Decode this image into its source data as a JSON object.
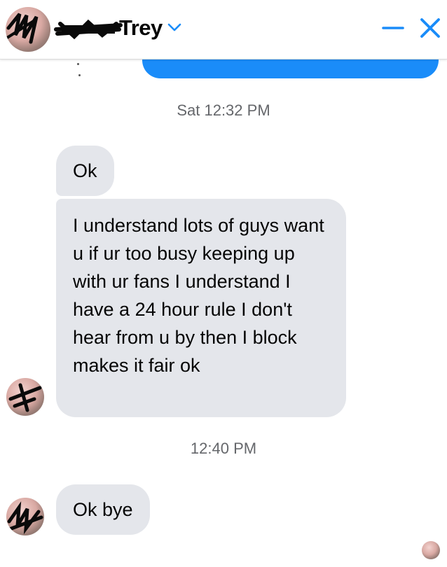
{
  "header": {
    "name": "Trey",
    "icons": {
      "chevron": "chevron-down-icon",
      "minimize": "minimize-icon",
      "close": "close-icon"
    },
    "accent_color": "#1a8cf9"
  },
  "messages": [
    {
      "type": "timestamp",
      "text": "Sat 12:32 PM"
    },
    {
      "type": "received",
      "text": "Ok"
    },
    {
      "type": "received",
      "text": "I understand lots of guys want u if ur too busy keeping up with ur fans I understand I have a 24 hour rule I don't hear from u by then I block makes it fair ok"
    },
    {
      "type": "timestamp",
      "text": "12:40 PM"
    },
    {
      "type": "received",
      "text": "Ok bye"
    }
  ],
  "colors": {
    "bubble_received": "#e4e6eb",
    "bubble_sent": "#1a8cf9",
    "timestamp_text": "#65676b"
  }
}
